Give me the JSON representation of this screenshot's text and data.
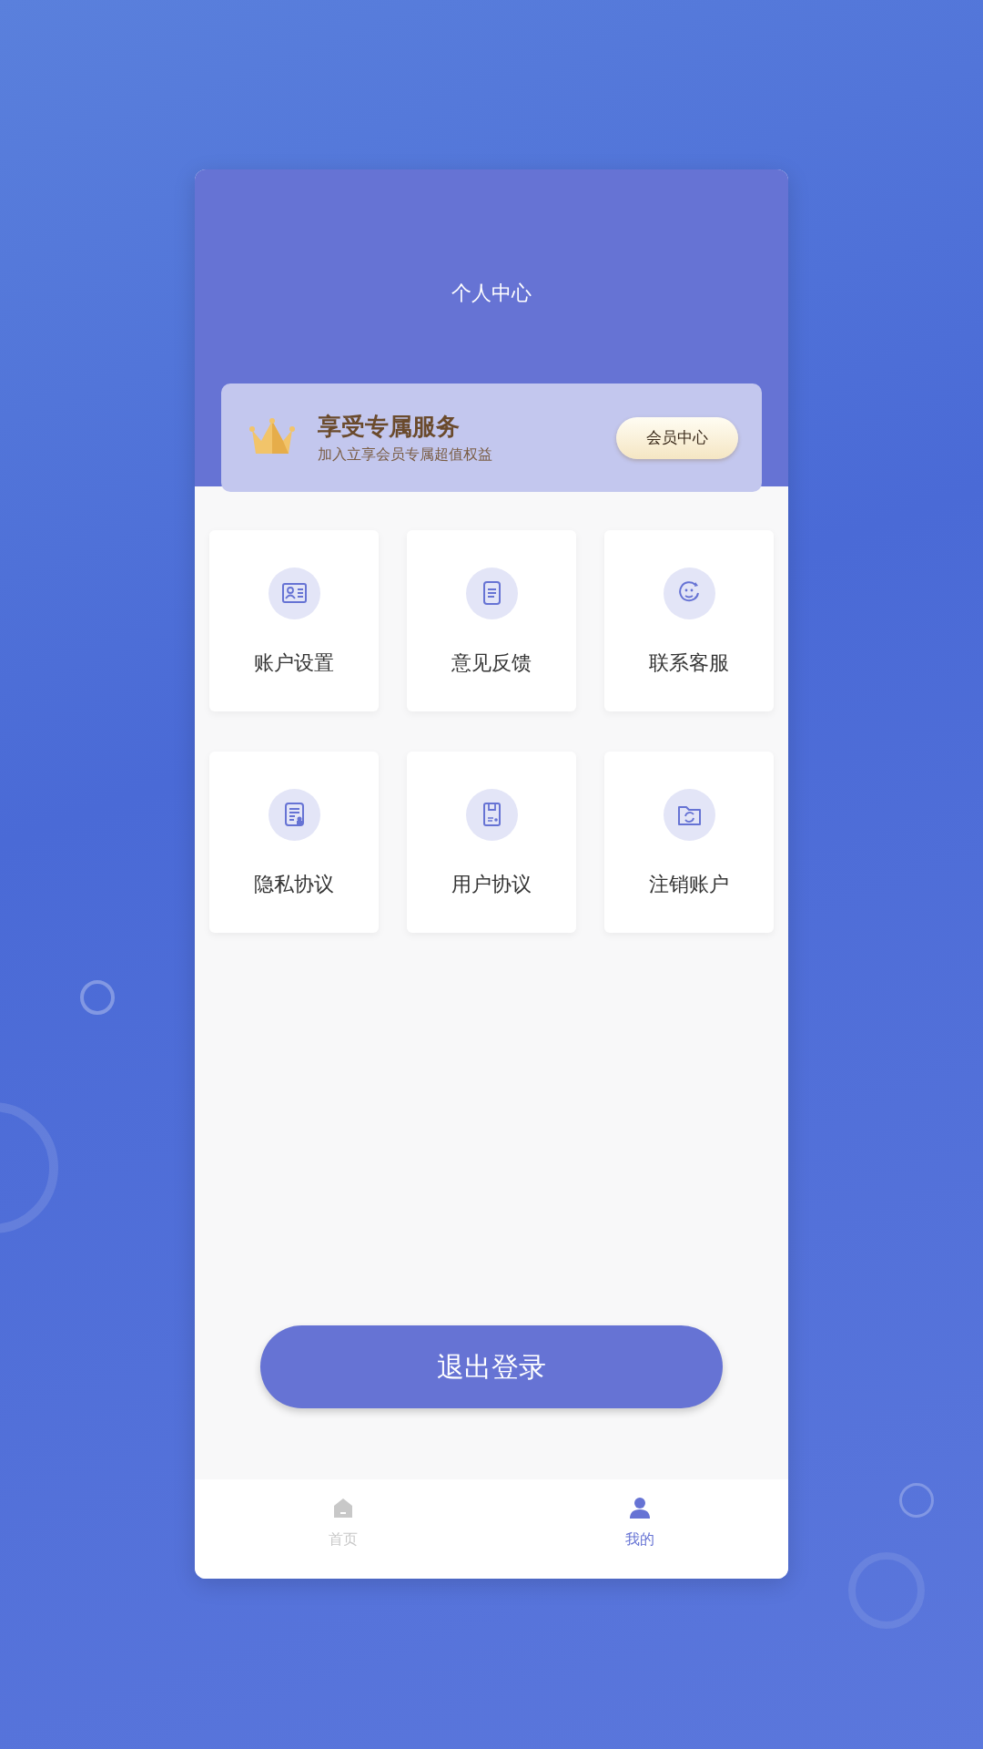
{
  "header": {
    "title": "个人中心"
  },
  "vip_banner": {
    "title": "享受专属服务",
    "subtitle": "加入立享会员专属超值权益",
    "button": "会员中心"
  },
  "menu": [
    {
      "label": "账户设置"
    },
    {
      "label": "意见反馈"
    },
    {
      "label": "联系客服"
    },
    {
      "label": "隐私协议"
    },
    {
      "label": "用户协议"
    },
    {
      "label": "注销账户"
    }
  ],
  "logout_button": "退出登录",
  "tabs": [
    {
      "label": "首页",
      "selected": false
    },
    {
      "label": "我的",
      "selected": true
    }
  ]
}
